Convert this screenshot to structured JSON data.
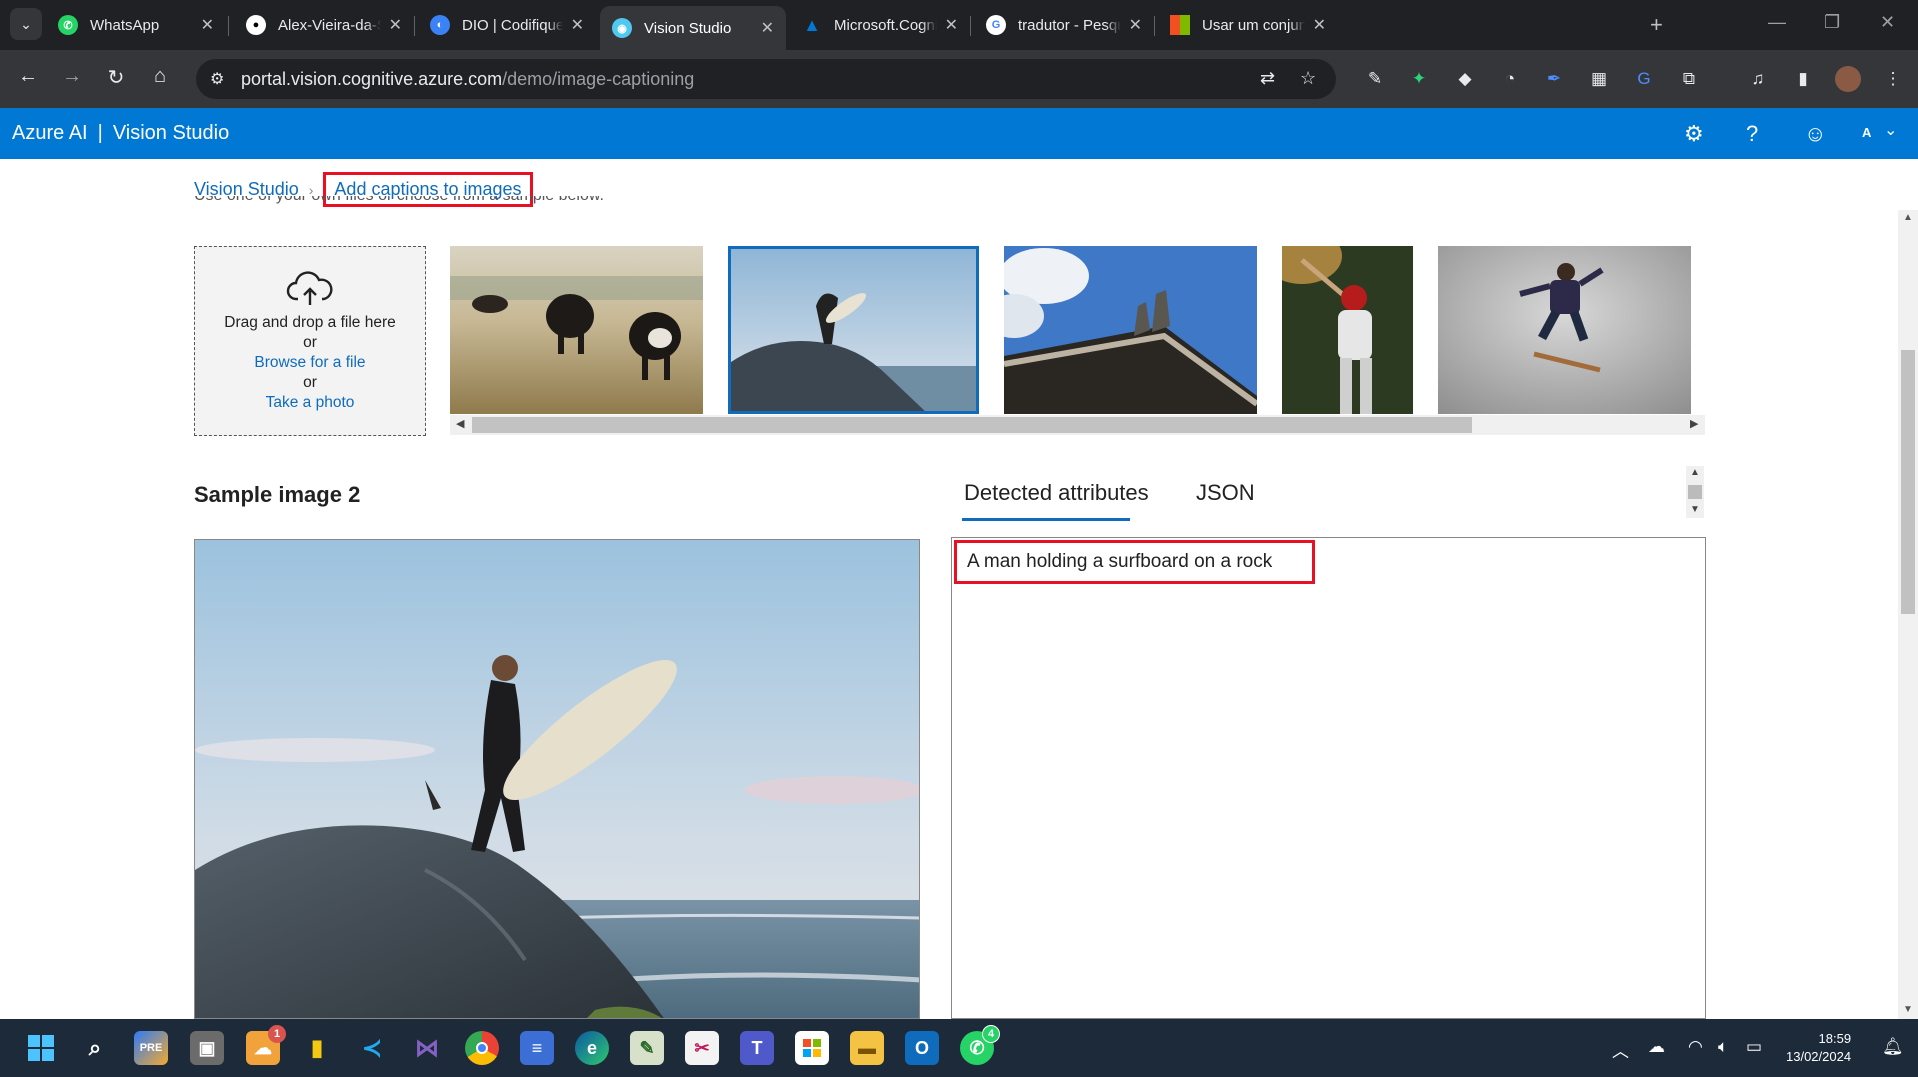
{
  "browser": {
    "tabs": [
      {
        "title": "WhatsApp",
        "icon": "whatsapp-icon",
        "color": "#25d366"
      },
      {
        "title": "Alex-Vieira-da-Silva (",
        "icon": "github-icon",
        "color": "#ffffff"
      },
      {
        "title": "DIO | Codifique o seu",
        "icon": "dio-icon",
        "color": "#3b82f6"
      },
      {
        "title": "Vision Studio",
        "icon": "vision-studio-icon",
        "color": "#50c8f0"
      },
      {
        "title": "Microsoft.CognitiveS",
        "icon": "azure-icon",
        "color": "#0078d4"
      },
      {
        "title": "tradutor - Pesquisa G",
        "icon": "google-icon",
        "color": "#ffffff"
      },
      {
        "title": "Usar um conjunto de",
        "icon": "microsoft-icon",
        "color": "#f25022"
      }
    ],
    "url_host": "portal.vision.cognitive.azure.com",
    "url_path": "/demo/image-captioning"
  },
  "header": {
    "brand": "Azure AI",
    "separator": "|",
    "product": "Vision Studio",
    "user_initial": "A"
  },
  "breadcrumb": {
    "root": "Vision Studio",
    "current": "Add captions to images"
  },
  "intro_partial": "Use one of your own files or choose from a sample below.",
  "upload": {
    "line1": "Drag and drop a file here",
    "or1": "or",
    "browse": "Browse for a file",
    "or2": "or",
    "photo": "Take a photo"
  },
  "sample": {
    "title": "Sample image 2"
  },
  "result_tabs": {
    "attributes": "Detected attributes",
    "json": "JSON"
  },
  "caption": "A man holding a surfboard on a rock",
  "taskbar": {
    "time": "18:59",
    "date": "13/02/2024",
    "badges": {
      "weather": "1",
      "whatsapp": "4"
    }
  },
  "colors": {
    "azure_blue": "#0078d4",
    "link_blue": "#0f6cbd",
    "highlight_red": "#e81123"
  }
}
